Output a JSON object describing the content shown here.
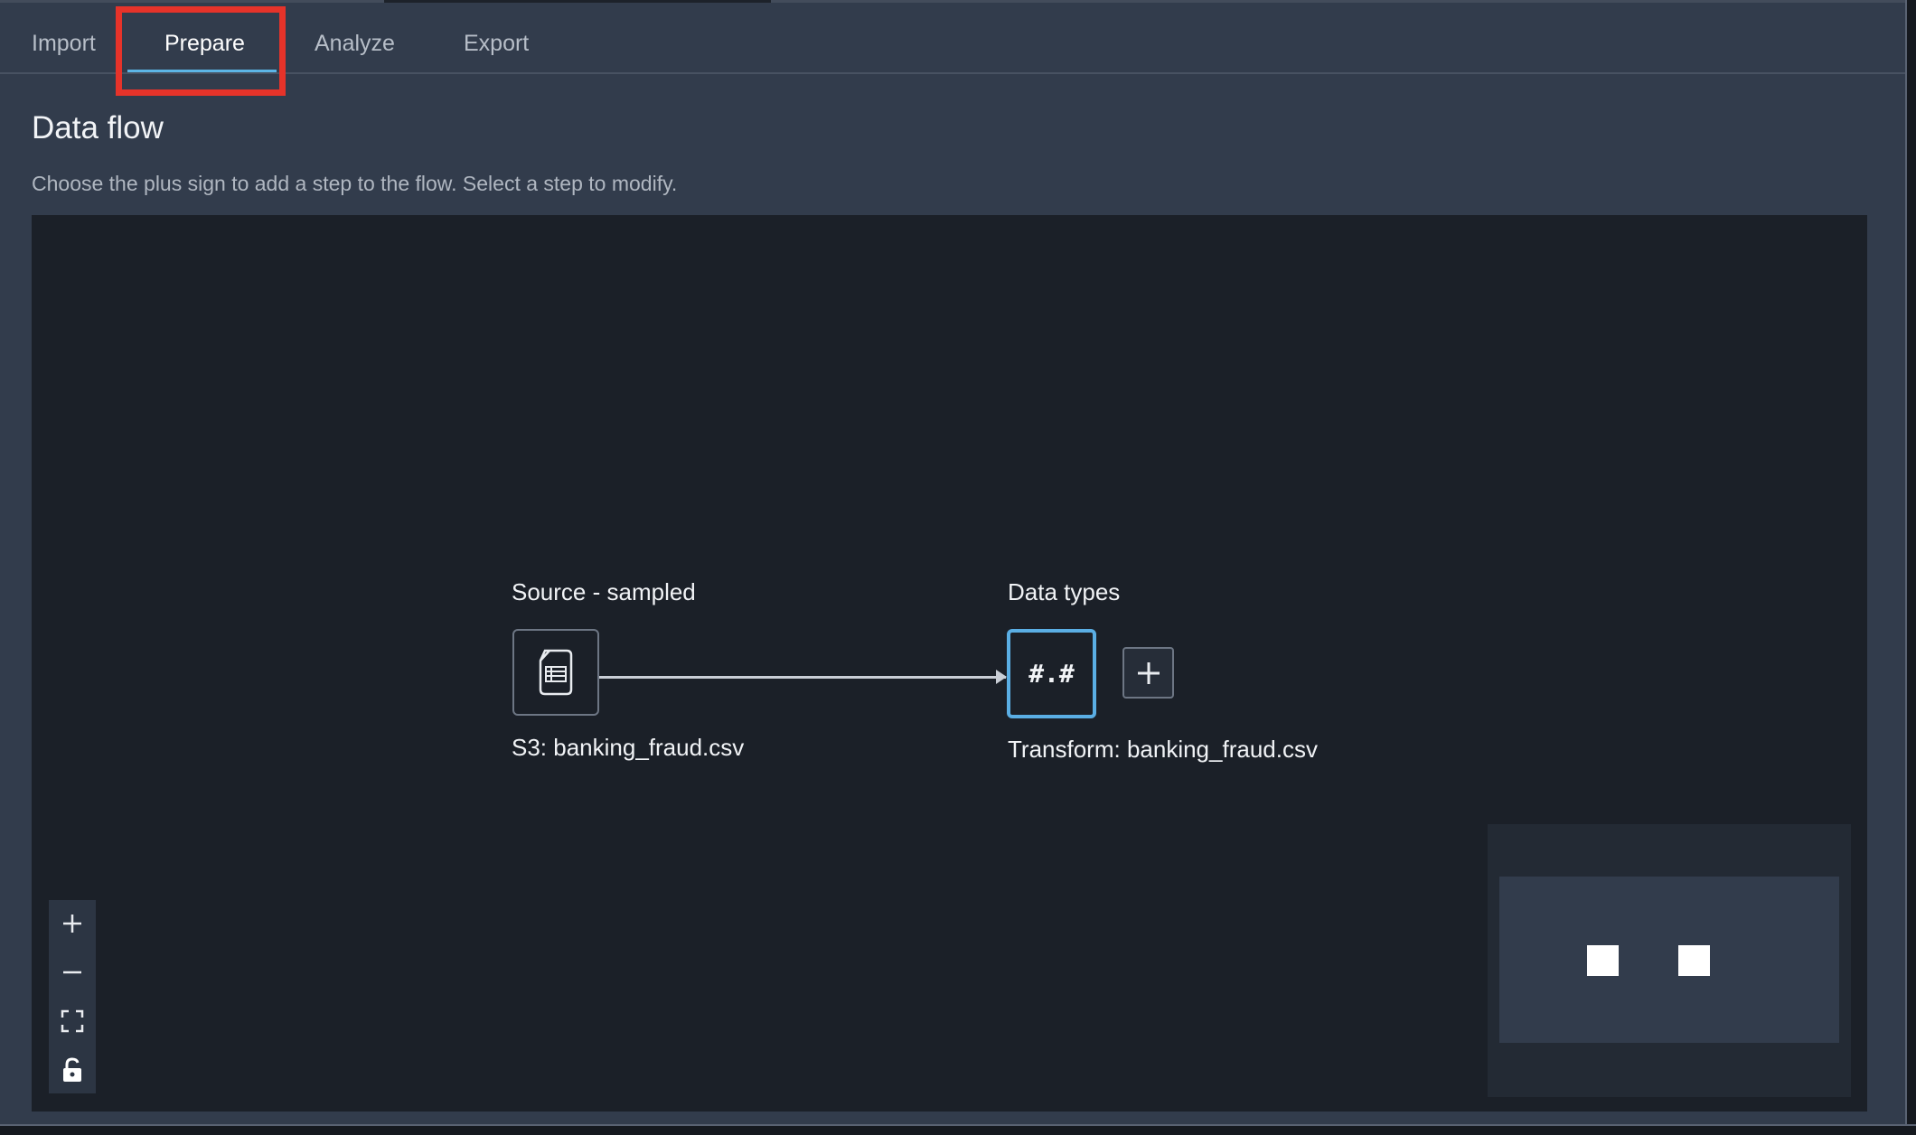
{
  "tabs": [
    {
      "label": "Import",
      "active": false
    },
    {
      "label": "Prepare",
      "active": true
    },
    {
      "label": "Analyze",
      "active": false
    },
    {
      "label": "Export",
      "active": false
    }
  ],
  "header": {
    "title": "Data flow",
    "subtitle": "Choose the plus sign to add a step to the flow. Select a step to modify."
  },
  "flow": {
    "source": {
      "label": "Source - sampled",
      "caption": "S3: banking_fraud.csv",
      "icon": "file-table-icon"
    },
    "transform": {
      "label": "Data types",
      "caption": "Transform: banking_fraud.csv",
      "glyph": "#.#"
    }
  },
  "colors": {
    "accent": "#5aaee4",
    "highlight": "#e6332a",
    "canvas": "#1b2028",
    "panel": "#323c4c"
  }
}
